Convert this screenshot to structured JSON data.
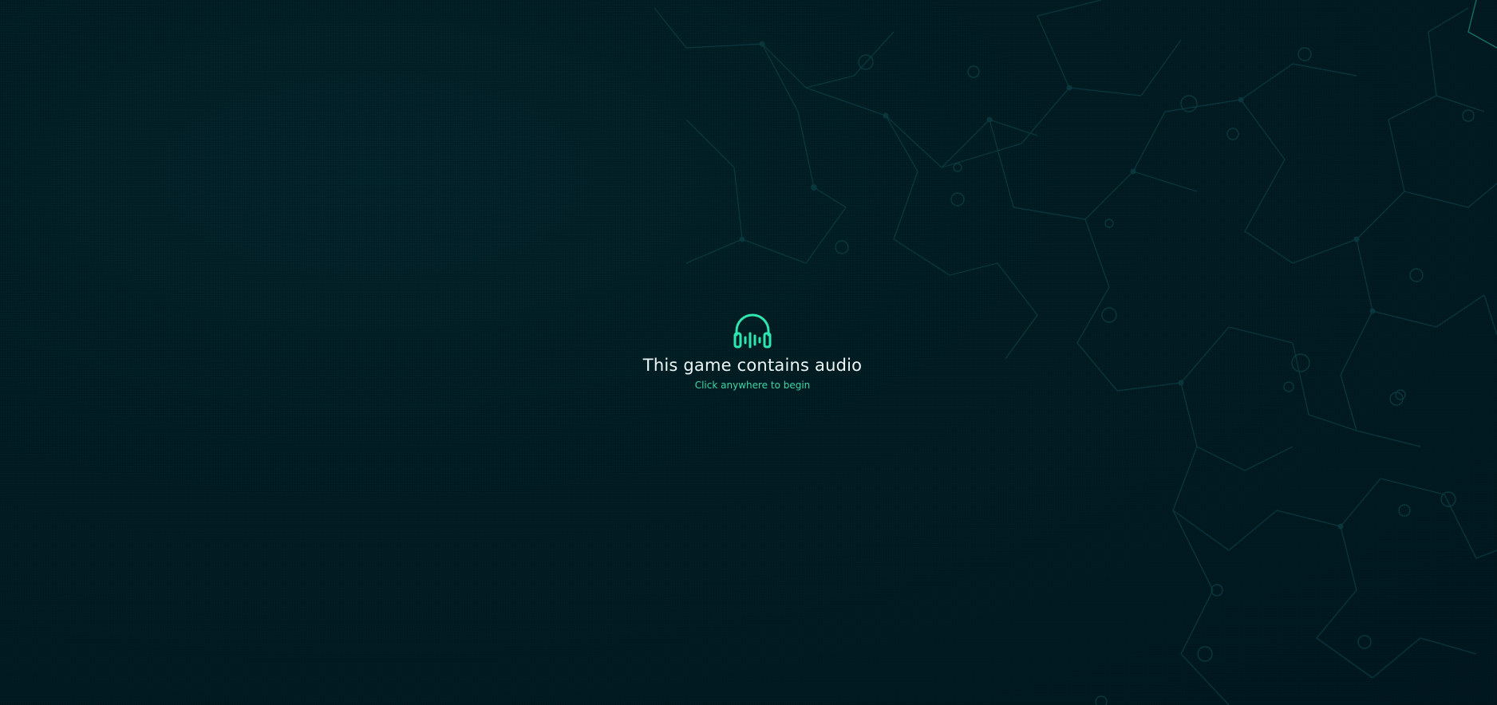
{
  "audio_prompt": {
    "icon": "headphones-icon",
    "title": "This game contains audio",
    "subtitle": "Click anywhere to begin"
  },
  "colors": {
    "background": "#001a20",
    "accent": "#2ee6b0",
    "title_text": "#eef6f5",
    "subtitle_text": "#3fd6a6",
    "network_lines": "#0b3a3f"
  }
}
